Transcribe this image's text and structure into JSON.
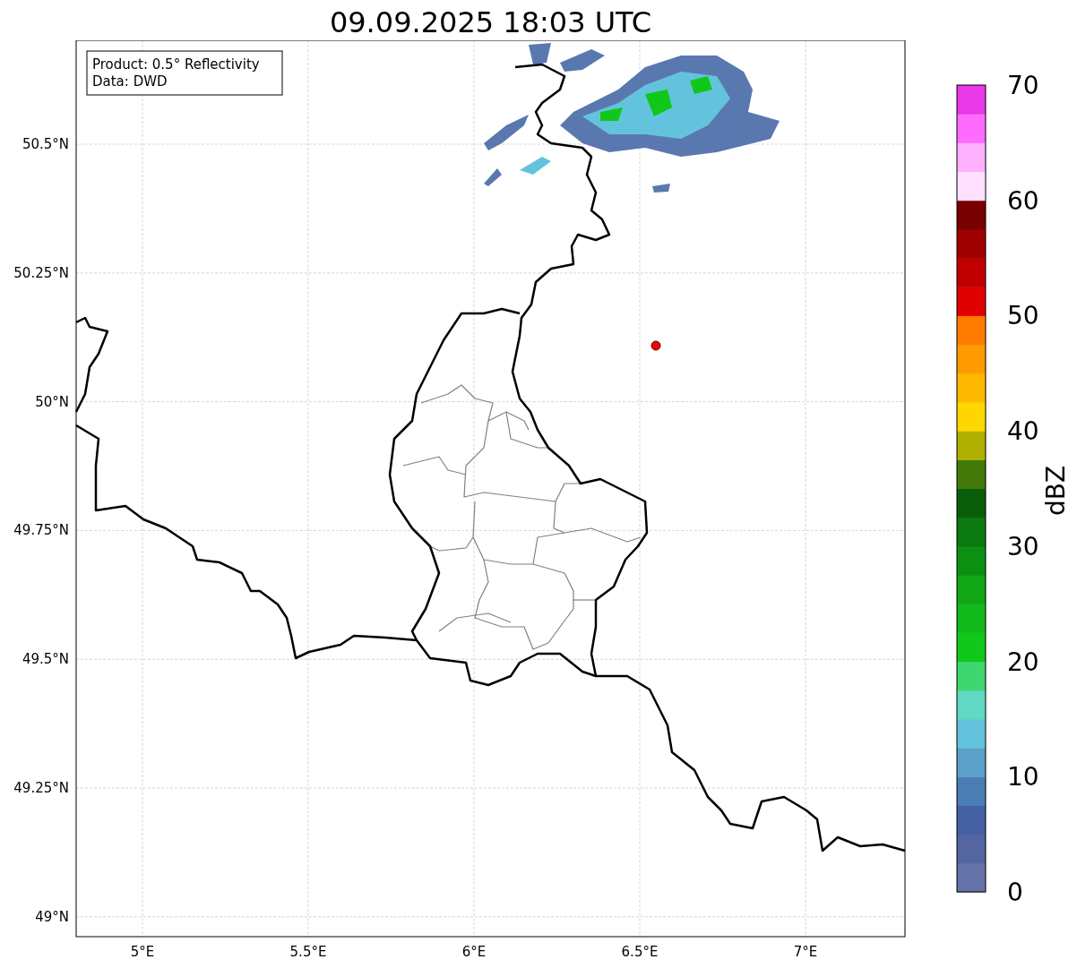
{
  "title": "09.09.2025 18:03 UTC",
  "info_box": {
    "lines": [
      "Product: 0.5° Reflectivity",
      "Data: DWD"
    ]
  },
  "map": {
    "x_ticks": [
      "5°E",
      "5.5°E",
      "6°E",
      "6.5°E",
      "7°E"
    ],
    "y_ticks": [
      "50.5°N",
      "50.25°N",
      "50°N",
      "49.75°N",
      "49.5°N",
      "49.25°N",
      "49°N"
    ]
  },
  "colorbar": {
    "label": "dBZ",
    "ticks": [
      "70",
      "60",
      "50",
      "40",
      "30",
      "20",
      "10",
      "0"
    ],
    "bins": [
      {
        "color": "#6474a8"
      },
      {
        "color": "#5466a0"
      },
      {
        "color": "#4560a3"
      },
      {
        "color": "#4a7db3"
      },
      {
        "color": "#5aa0c8"
      },
      {
        "color": "#64c3dc"
      },
      {
        "color": "#60d8c4"
      },
      {
        "color": "#3ed66e"
      },
      {
        "color": "#10c81a"
      },
      {
        "color": "#10b81a"
      },
      {
        "color": "#10a615"
      },
      {
        "color": "#0c9012"
      },
      {
        "color": "#0b7a10"
      },
      {
        "color": "#0a5e0a"
      },
      {
        "color": "#447a0a"
      },
      {
        "color": "#b0b000"
      },
      {
        "color": "#ffd700"
      },
      {
        "color": "#ffb800"
      },
      {
        "color": "#ff9a00"
      },
      {
        "color": "#ff7a00"
      },
      {
        "color": "#e00000"
      },
      {
        "color": "#c00000"
      },
      {
        "color": "#a00000"
      },
      {
        "color": "#780000"
      },
      {
        "color": "#ffe0ff"
      },
      {
        "color": "#ffb0ff"
      },
      {
        "color": "#ff6aff"
      },
      {
        "color": "#e838e8"
      }
    ]
  }
}
